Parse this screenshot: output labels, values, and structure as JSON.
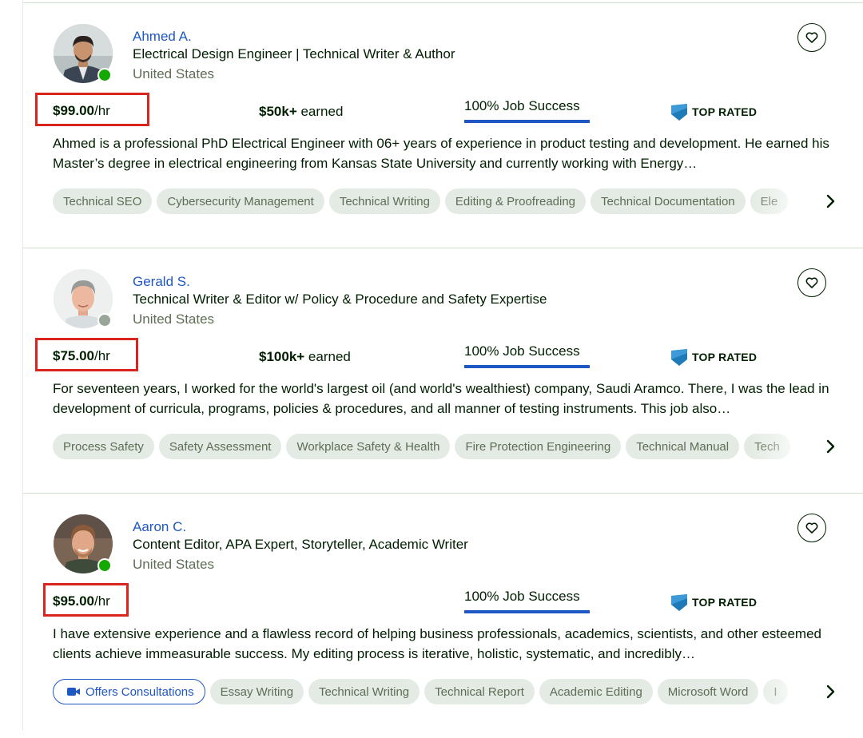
{
  "freelancers": [
    {
      "name": "Ahmed A.",
      "title": "Electrical Design Engineer | Technical Writer & Author",
      "location": "United States",
      "status": "online",
      "rate": "$99.00",
      "rate_unit": "/hr",
      "earned_amount": "$50k+",
      "earned_label": " earned",
      "job_success": "100% Job Success",
      "job_success_percent": 100,
      "badge": "TOP RATED",
      "description": "Ahmed is a professional PhD Electrical Engineer with 06+ years of experience in product testing and development. He earned his Master’s degree in electrical engineering from Kansas State University and currently working with Energy…",
      "skills": [
        "Technical SEO",
        "Cybersecurity Management",
        "Technical Writing",
        "Editing & Proofreading",
        "Technical Documentation",
        "Ele"
      ]
    },
    {
      "name": "Gerald S.",
      "title": "Technical Writer & Editor w/ Policy & Procedure and Safety Expertise",
      "location": "United States",
      "status": "offline",
      "rate": "$75.00",
      "rate_unit": "/hr",
      "earned_amount": "$100k+",
      "earned_label": " earned",
      "job_success": "100% Job Success",
      "job_success_percent": 100,
      "badge": "TOP RATED",
      "description": "For seventeen years, I worked for the world's largest oil (and world's wealthiest) company, Saudi Aramco. There, I was the lead in development of curricula, programs, policies & procedures, and all manner of testing instruments. This job also…",
      "skills": [
        "Process Safety",
        "Safety Assessment",
        "Workplace Safety & Health",
        "Fire Protection Engineering",
        "Technical Manual",
        "Tech"
      ]
    },
    {
      "name": "Aaron C.",
      "title": "Content Editor, APA Expert, Storyteller, Academic Writer",
      "location": "United States",
      "status": "online",
      "rate": "$95.00",
      "rate_unit": "/hr",
      "job_success": "100% Job Success",
      "job_success_percent": 100,
      "badge": "TOP RATED",
      "description": "I have extensive experience and a flawless record of helping business professionals, academics, scientists, and other esteemed clients achieve immeasurable success. My editing process is iterative, holistic, systematic, and incredibly…",
      "consultation_label": "Offers Consultations",
      "skills": [
        "Essay Writing",
        "Technical Writing",
        "Technical Report",
        "Academic Editing",
        "Microsoft Word",
        "I"
      ]
    }
  ],
  "icons": {
    "favorite": "heart-icon",
    "badge": "top-rated-badge-icon",
    "next": "chevron-right-icon",
    "consult": "video-camera-icon"
  },
  "colors": {
    "link": "#1f57c3",
    "online": "#14a800",
    "highlight": "#d9251d",
    "chip_bg": "#e4ebe4",
    "badge": "#1f7ab8"
  }
}
